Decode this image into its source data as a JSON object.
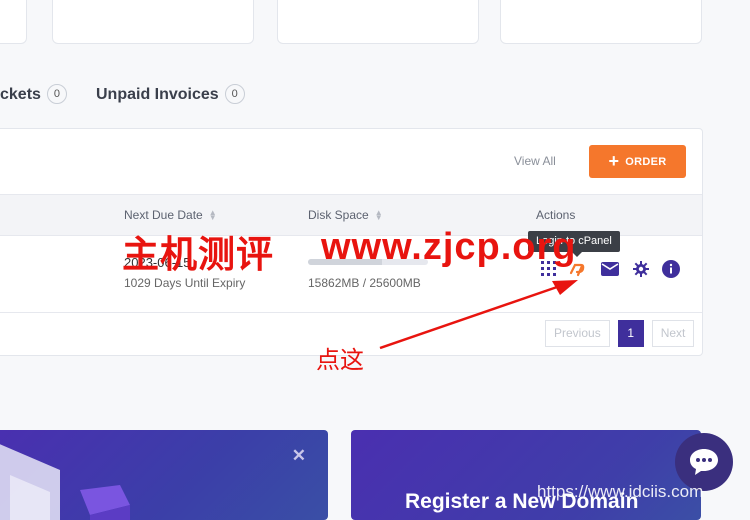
{
  "tabs": {
    "tickets_label": "ckets",
    "tickets_count": "0",
    "invoices_label": "Unpaid Invoices",
    "invoices_count": "0"
  },
  "panel": {
    "view_all": "View All",
    "order_label": "ORDER",
    "columns": {
      "next_due": "Next Due Date",
      "disk": "Disk Space",
      "actions": "Actions"
    },
    "row": {
      "due_date": "2023-06-15",
      "due_sub": "1029 Days Until Expiry",
      "disk_usage_fraction": 0.62,
      "disk_text": "15862MB / 25600MB"
    },
    "tooltip": "Login to cPanel",
    "action_icons": [
      "grid-icon",
      "cpanel-icon",
      "mail-icon",
      "gear-icon",
      "info-icon"
    ],
    "pagination": {
      "previous": "Previous",
      "page": "1",
      "next": "Next"
    }
  },
  "banners": {
    "right_title": "Register a New Domain"
  },
  "watermarks": {
    "cn": "主机测评",
    "url": "www.zjcp.org",
    "annotation": "点这",
    "bottom": "https://www.idciis.com"
  },
  "colors": {
    "accent_orange": "#f5772c",
    "brand_purple": "#3f2f9c",
    "watermark_red": "#e8140f"
  }
}
